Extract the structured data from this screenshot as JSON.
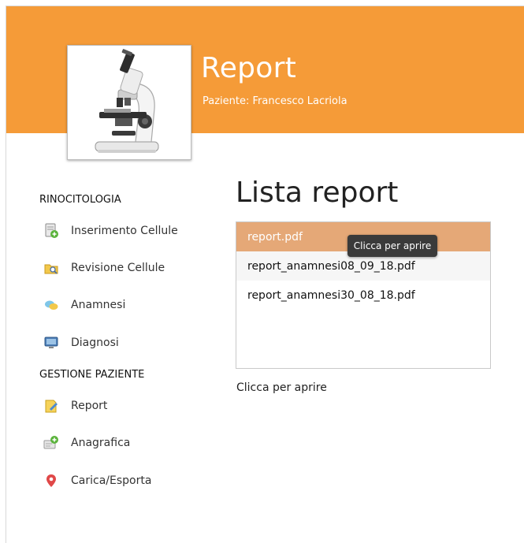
{
  "header": {
    "title": "Report",
    "patient_line": "Paziente: Francesco Lacriola",
    "logo_icon": "microscope-icon",
    "color": "#f59b38"
  },
  "sidebar": {
    "sections": [
      {
        "heading": "RINOCITOLOGIA",
        "items": [
          {
            "label": "Inserimento Cellule",
            "icon": "document-add-icon"
          },
          {
            "label": "Revisione Cellule",
            "icon": "folder-search-icon"
          },
          {
            "label": "Anamnesi",
            "icon": "chat-bubbles-icon"
          },
          {
            "label": "Diagnosi",
            "icon": "monitor-icon"
          }
        ]
      },
      {
        "heading": "GESTIONE PAZIENTE",
        "items": [
          {
            "label": "Report",
            "icon": "pencil-note-icon"
          },
          {
            "label": "Anagrafica",
            "icon": "id-card-add-icon"
          },
          {
            "label": "Carica/Esporta",
            "icon": "location-pin-icon"
          }
        ]
      }
    ]
  },
  "main": {
    "title": "Lista report",
    "reports": [
      "report.pdf",
      "report_anamnesi08_09_18.pdf",
      "report_anamnesi30_08_18.pdf"
    ],
    "selected_index": 0,
    "selected_color": "#e5a877",
    "tooltip": "Clicca per aprire",
    "hint": "Clicca per aprire"
  }
}
